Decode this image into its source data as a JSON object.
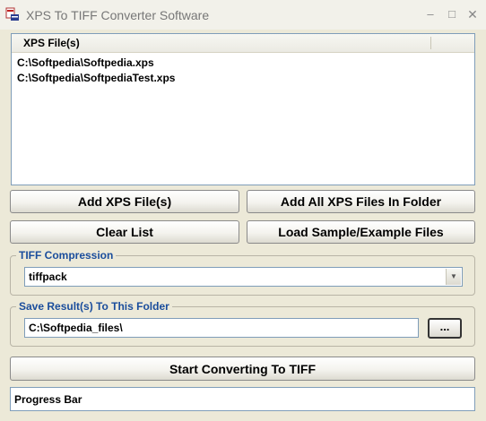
{
  "window": {
    "title": "XPS To TIFF Converter Software",
    "controls": {
      "minimize": "–",
      "maximize": "□",
      "close": "✕"
    }
  },
  "file_list": {
    "column_header": "XPS File(s)",
    "items": [
      "C:\\Softpedia\\Softpedia.xps",
      "C:\\Softpedia\\SoftpediaTest.xps"
    ]
  },
  "buttons": {
    "add_files": "Add XPS File(s)",
    "add_folder": "Add All XPS Files In Folder",
    "clear_list": "Clear List",
    "load_samples": "Load Sample/Example Files",
    "start": "Start Converting To TIFF"
  },
  "tiff_compression": {
    "label": "TIFF Compression",
    "selected": "tiffpack"
  },
  "save_folder": {
    "label": "Save Result(s) To This Folder",
    "value": "C:\\Softpedia_files\\",
    "browse_label": "..."
  },
  "progress": {
    "label": "Progress Bar"
  }
}
